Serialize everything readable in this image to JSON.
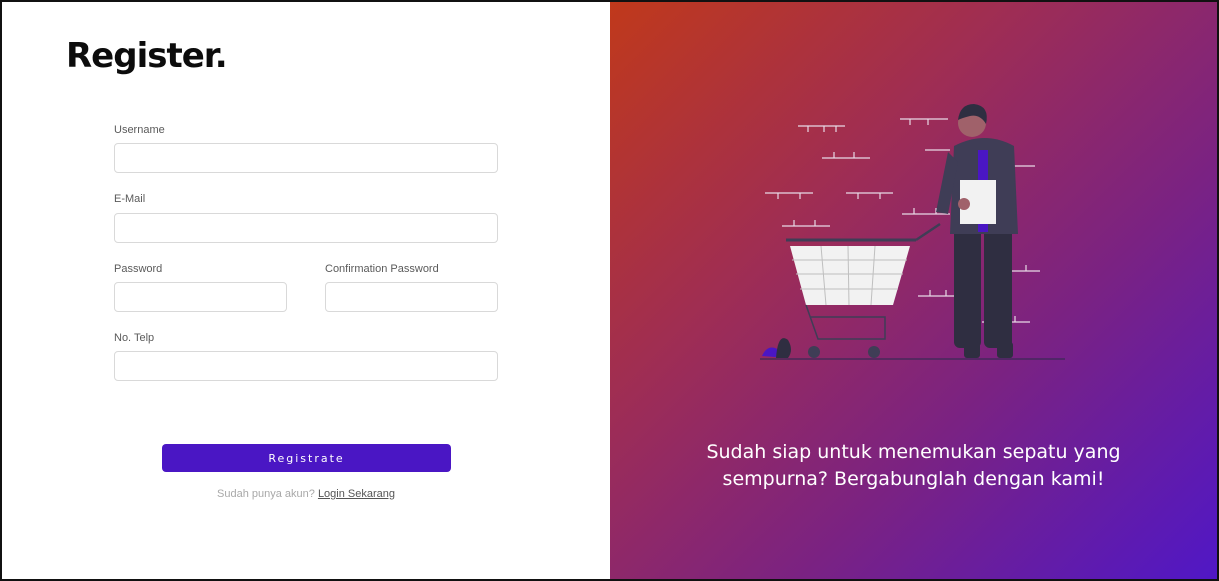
{
  "form": {
    "title": "Register.",
    "username": {
      "label": "Username",
      "value": "",
      "placeholder": ""
    },
    "email": {
      "label": "E-Mail",
      "value": "",
      "placeholder": ""
    },
    "password": {
      "label": "Password",
      "value": "",
      "placeholder": ""
    },
    "confirm_password": {
      "label": "Confirmation Password",
      "value": "",
      "placeholder": ""
    },
    "phone": {
      "label": "No. Telp",
      "value": "",
      "placeholder": ""
    },
    "submit_label": "Registrate",
    "login_prompt": "Sudah punya akun?",
    "login_link": "Login Sekarang"
  },
  "promo": {
    "tagline": "Sudah siap untuk menemukan sepatu yang sempurna? Bergabunglah dengan kami!",
    "illustration": "person-with-shopping-cart"
  },
  "colors": {
    "button": "#4a16c4",
    "gradient_start": "#c0391b",
    "gradient_end": "#5017c6"
  }
}
